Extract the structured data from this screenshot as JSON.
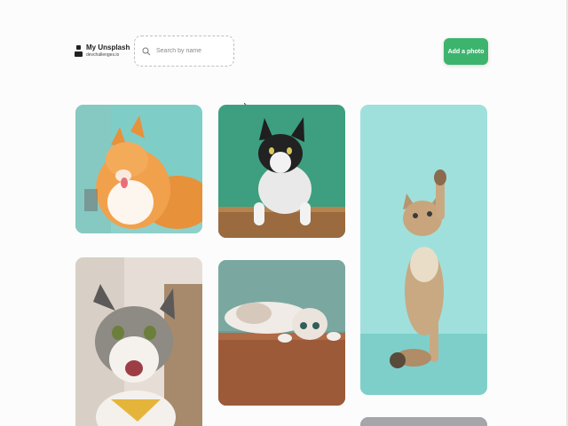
{
  "brand": {
    "title": "My Unsplash",
    "subtitle": "devchallenges.io"
  },
  "search": {
    "placeholder": "Search by name",
    "value": "",
    "icon": "search-icon"
  },
  "actions": {
    "add_photo_label": "Add a photo",
    "accent_color": "#3db46d"
  },
  "gallery": {
    "photos": [
      {
        "subject": "orange tabby cat licking"
      },
      {
        "subject": "black and white cat on green wall"
      },
      {
        "subject": "tabby kitten reaching up on teal background"
      },
      {
        "subject": "cat with yellow bandana smiling"
      },
      {
        "subject": "cat lying upside down on wooden floor"
      },
      {
        "subject": "grey photo partially visible"
      }
    ]
  }
}
